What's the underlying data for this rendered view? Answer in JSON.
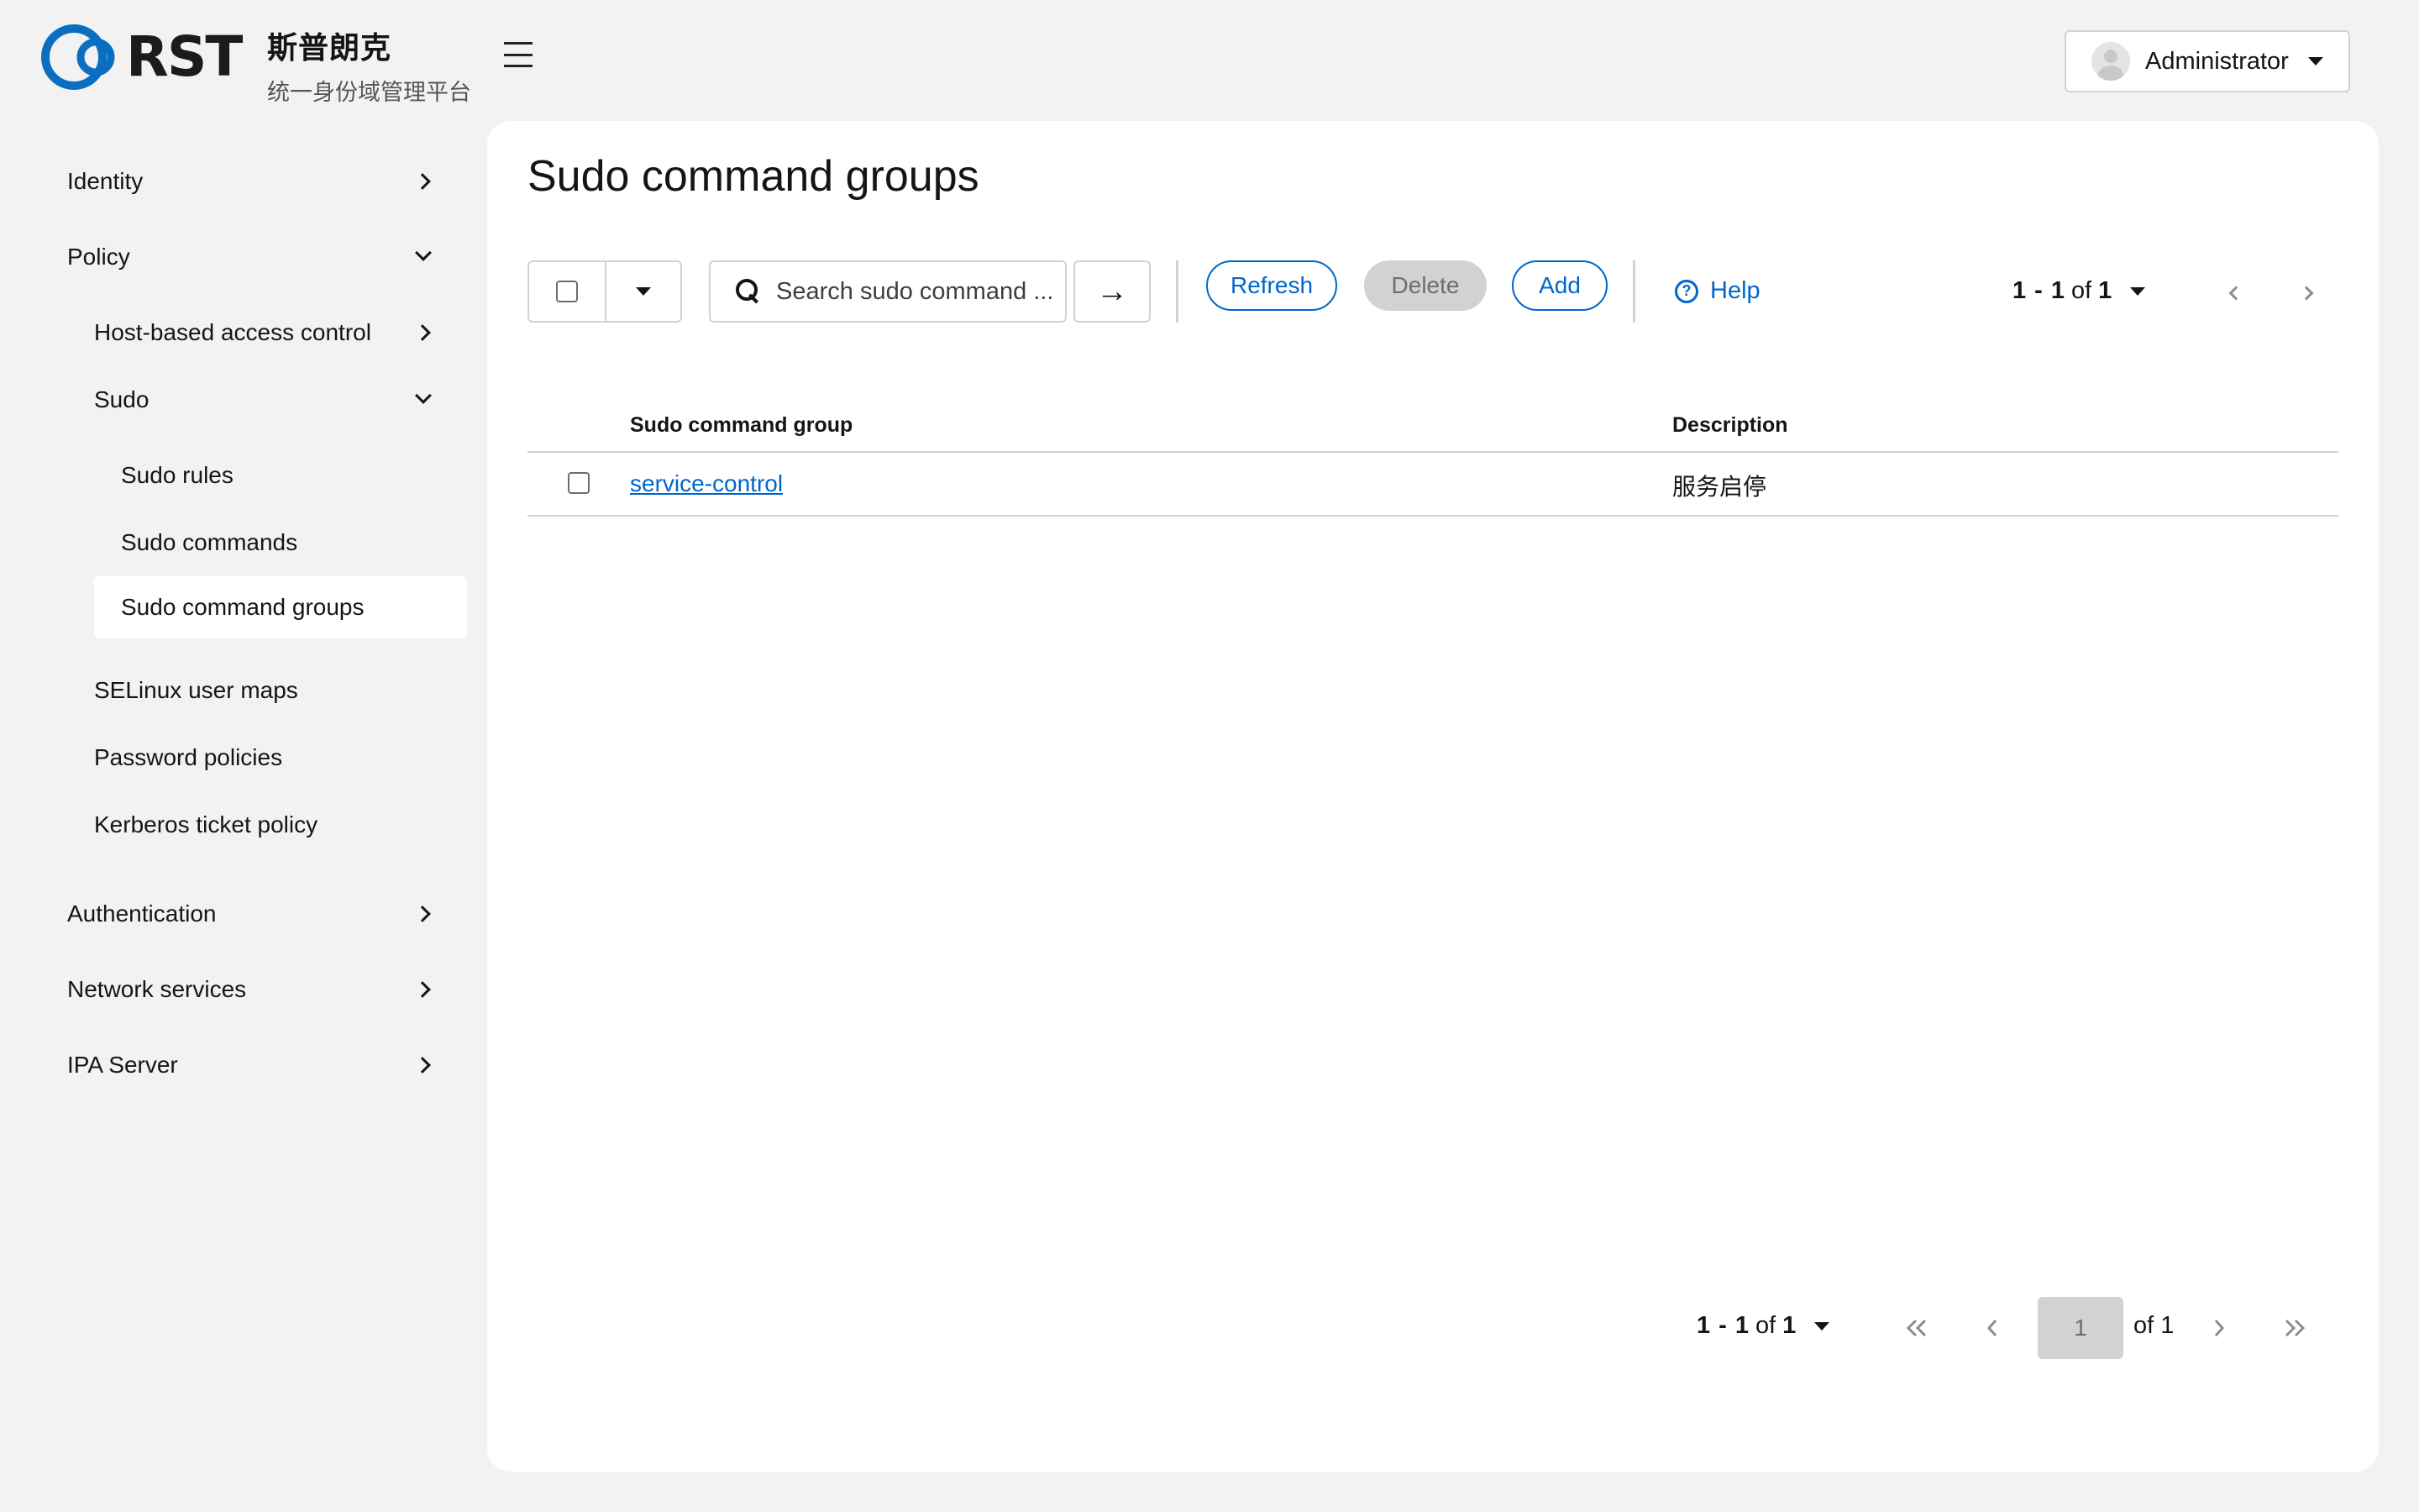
{
  "header": {
    "logo_text": "RST",
    "brand_name": "斯普朗克",
    "brand_subtitle": "统一身份域管理平台",
    "user_name": "Administrator"
  },
  "sidebar": {
    "items": [
      {
        "label": "Identity",
        "state": "collapsed"
      },
      {
        "label": "Policy",
        "state": "expanded"
      },
      {
        "label": "Host-based access control",
        "state": "collapsed"
      },
      {
        "label": "Sudo",
        "state": "expanded"
      },
      {
        "label": "Sudo rules"
      },
      {
        "label": "Sudo commands"
      },
      {
        "label": "Sudo command groups",
        "active": true
      },
      {
        "label": "SELinux user maps"
      },
      {
        "label": "Password policies"
      },
      {
        "label": "Kerberos ticket policy"
      },
      {
        "label": "Authentication",
        "state": "collapsed"
      },
      {
        "label": "Network services",
        "state": "collapsed"
      },
      {
        "label": "IPA Server",
        "state": "collapsed"
      }
    ]
  },
  "main": {
    "title": "Sudo command groups",
    "toolbar": {
      "search_placeholder": "Search sudo command ...",
      "refresh_label": "Refresh",
      "delete_label": "Delete",
      "add_label": "Add",
      "help_label": "Help"
    },
    "pagination": {
      "range_start": "1",
      "range_end": "1",
      "of_word": "of",
      "total": "1",
      "current_page": "1",
      "total_pages_label": "of 1"
    },
    "table": {
      "columns": [
        "Sudo command group",
        "Description"
      ],
      "rows": [
        {
          "name": "service-control",
          "description": "服务启停"
        }
      ]
    }
  },
  "colors": {
    "accent": "#0066cc",
    "brand_ring": "#0b6fc1",
    "page_bg": "#f2f2f2",
    "panel_bg": "#ffffff",
    "border": "#d2d2d2"
  },
  "icons": [
    "hamburger-icon",
    "user-avatar-icon",
    "caret-down-icon",
    "chevron-right-icon",
    "chevron-down-icon",
    "search-icon",
    "arrow-right-icon",
    "help-icon",
    "angle-left-icon",
    "angle-right-icon",
    "angle-double-left-icon",
    "angle-double-right-icon"
  ]
}
